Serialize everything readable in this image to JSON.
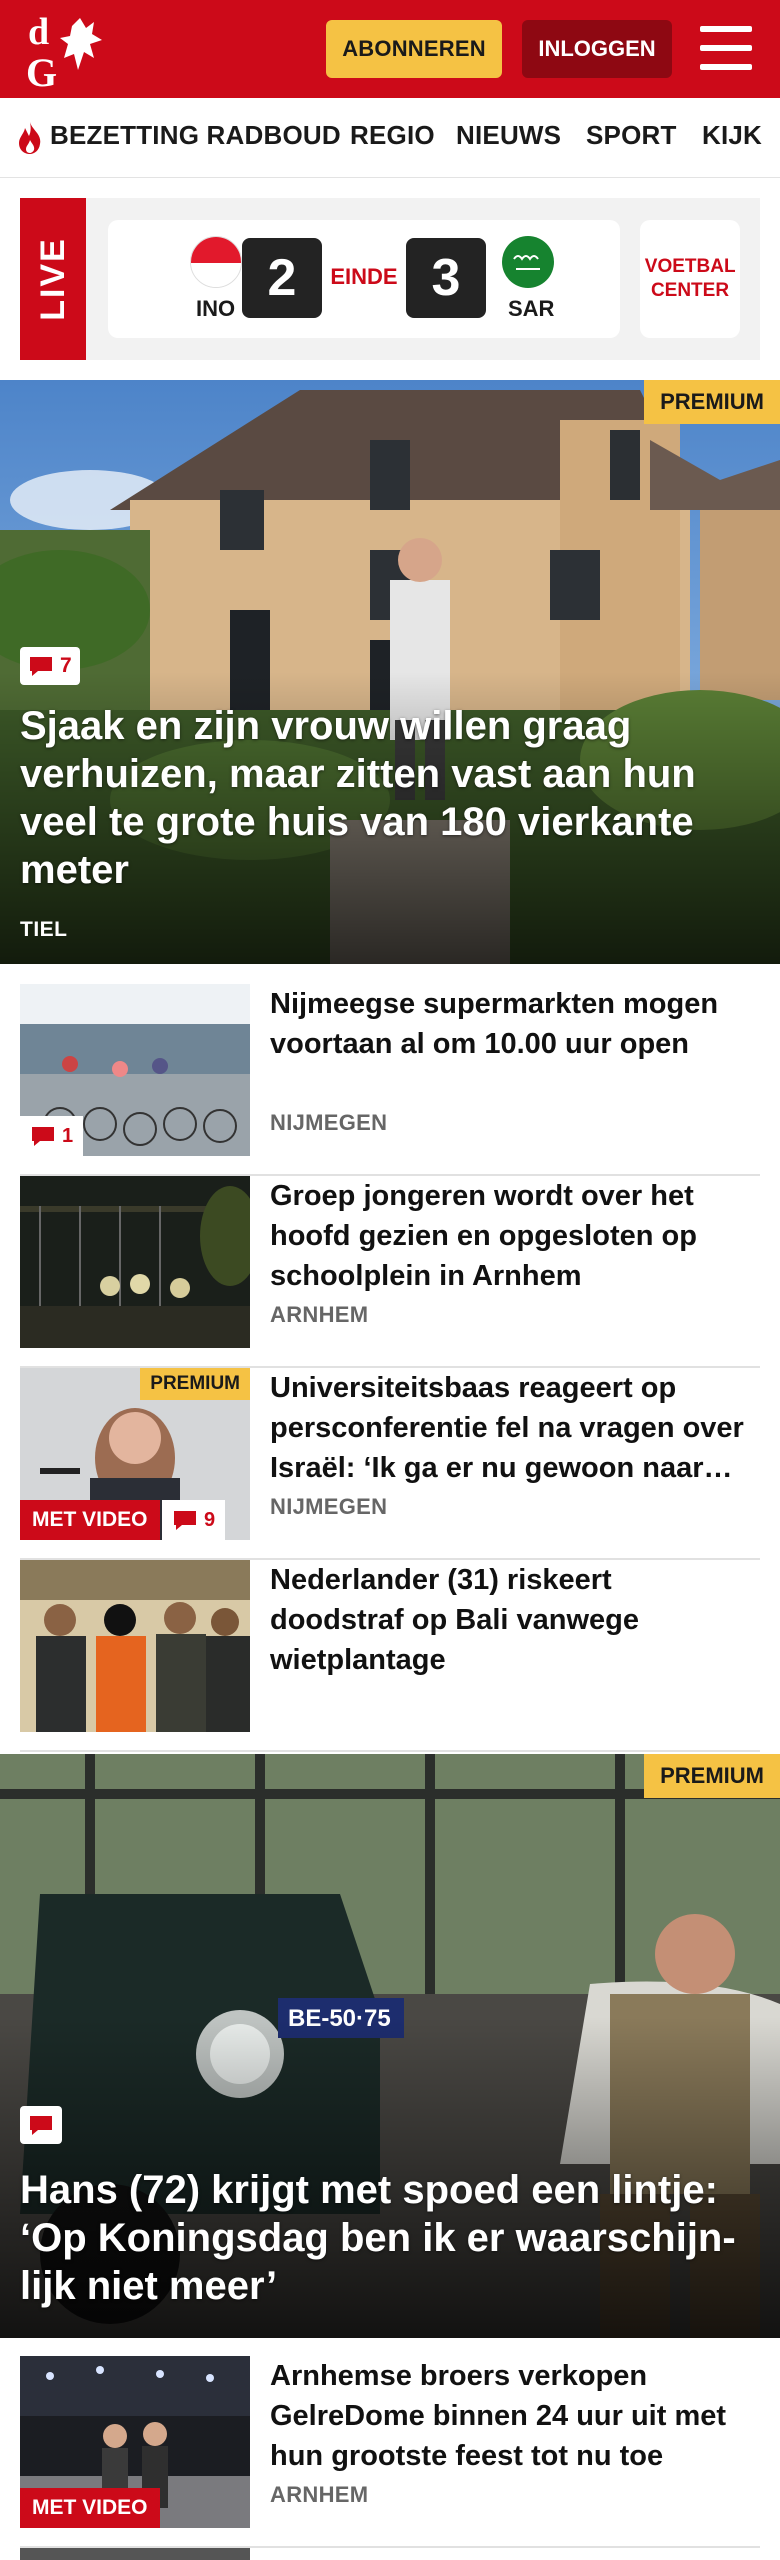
{
  "header": {
    "subscribe_label": "ABONNEREN",
    "login_label": "INLOGGEN",
    "logo_alt": "dG",
    "brand_color": "#cc0a19",
    "accent_color": "#f5c244"
  },
  "nav": {
    "items": [
      "BEZETTING RADBOUD",
      "REGIO",
      "NIEUWS",
      "SPORT",
      "KIJK"
    ]
  },
  "live": {
    "tag": "LIVE",
    "home_team": "INO",
    "away_team": "SAR",
    "home_score": "2",
    "away_score": "3",
    "status": "EINDE",
    "voetbal_center": "VOETBAL CENTER"
  },
  "hero1": {
    "premium": "PREMIUM",
    "comments": "7",
    "title": "Sjaak en zijn vrouw willen graag verhuizen, maar zitten vast aan hun veel te grote huis van 180 vierkante meter",
    "location": "TIEL"
  },
  "articles": [
    {
      "title": "Nijmeegse supermarkten mogen voortaan al om 10.00 uur open",
      "location": "NIJMEGEN",
      "comments": "1"
    },
    {
      "title": "Groep jongeren wordt over het hoofd gezien en opgesloten op schoolplein in Arnhem",
      "location": "ARNHEM"
    },
    {
      "title": "Universiteitsbaas reageert op persconferentie fel na vragen over Israël: ‘Ik ga er nu gewoon naar huis’",
      "location": "NIJMEGEN",
      "premium": "PREMIUM",
      "video": "MET VIDEO",
      "comments": "9"
    },
    {
      "title": "Nederlander (31) riskeert doodstraf op Bali vanwege wietplantage",
      "location": ""
    }
  ],
  "hero2": {
    "premium": "PREMIUM",
    "title": "Hans (72) krijgt met spoed een lintje: ‘Op Koningsdag ben ik er waarschijn-lijk niet meer’",
    "plate": "BE-50·75"
  },
  "article_last": {
    "title": "Arnhemse broers verkopen GelreDome binnen 24 uur uit met hun grootste feest tot nu toe",
    "location": "ARNHEM",
    "video": "MET VIDEO"
  }
}
